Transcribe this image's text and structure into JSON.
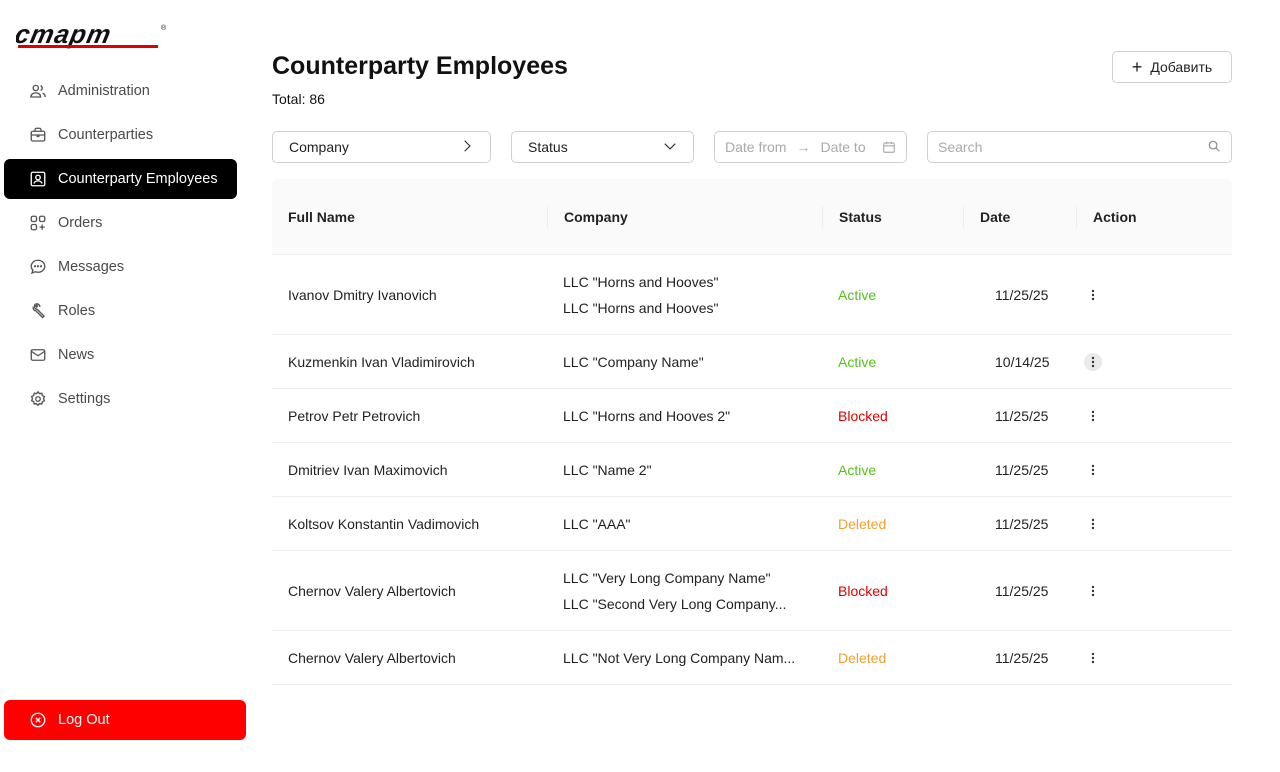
{
  "brand": {
    "logo_text": "старт",
    "accent": "#ff0000"
  },
  "sidebar": {
    "items": [
      {
        "label": "Administration",
        "icon": "users-icon",
        "active": false
      },
      {
        "label": "Counterparties",
        "icon": "briefcase-icon",
        "active": false
      },
      {
        "label": "Counterparty Employees",
        "icon": "id-card-icon",
        "active": true
      },
      {
        "label": "Orders",
        "icon": "apps-icon",
        "active": false
      },
      {
        "label": "Messages",
        "icon": "chat-icon",
        "active": false
      },
      {
        "label": "Roles",
        "icon": "wrench-icon",
        "active": false
      },
      {
        "label": "News",
        "icon": "mail-icon",
        "active": false
      },
      {
        "label": "Settings",
        "icon": "gear-icon",
        "active": false
      }
    ],
    "logout_label": "Log Out"
  },
  "page": {
    "title": "Counterparty Employees",
    "total": "Total: 86",
    "add_label": "Добавить"
  },
  "filters": {
    "company": "Company",
    "status": "Status",
    "date_from": "Date from",
    "date_arrow": "→",
    "date_to": "Date to",
    "search_placeholder": "Search"
  },
  "table": {
    "headers": [
      "Full Name",
      "Company",
      "Status",
      "Date",
      "Action"
    ],
    "rows": [
      {
        "name": "Ivanov Dmitry Ivanovich",
        "companies": [
          "LLC \"Horns and Hooves\"",
          "LLC \"Horns and Hooves\""
        ],
        "status": "Active",
        "status_type": "active",
        "date": "11/25/25"
      },
      {
        "name": "Kuzmenkin Ivan Vladimirovich",
        "companies": [
          "LLC \"Company Name\""
        ],
        "status": "Active",
        "status_type": "active",
        "date": "10/14/25"
      },
      {
        "name": "Petrov Petr Petrovich",
        "companies": [
          "LLC \"Horns and Hooves 2\""
        ],
        "status": "Blocked",
        "status_type": "blocked",
        "date": "11/25/25"
      },
      {
        "name": "Dmitriev Ivan Maximovich",
        "companies": [
          "LLC \"Name 2\""
        ],
        "status": "Active",
        "status_type": "active",
        "date": "11/25/25"
      },
      {
        "name": "Koltsov Konstantin Vadimovich",
        "companies": [
          "LLC \"AAA\""
        ],
        "status": "Deleted",
        "status_type": "deleted",
        "date": "11/25/25"
      },
      {
        "name": "Chernov Valery Albertovich",
        "companies": [
          "LLC \"Very Long Company Name\"",
          "LLC \"Second Very Long Company..."
        ],
        "status": "Blocked",
        "status_type": "blocked",
        "date": "11/25/25"
      },
      {
        "name": "Chernov Valery Albertovich",
        "companies": [
          "LLC \"Not Very Long Company Nam..."
        ],
        "status": "Deleted",
        "status_type": "deleted",
        "date": "11/25/25"
      }
    ]
  },
  "colors": {
    "active": "#52c41a",
    "blocked": "#e00000",
    "deleted": "#f0a030"
  }
}
